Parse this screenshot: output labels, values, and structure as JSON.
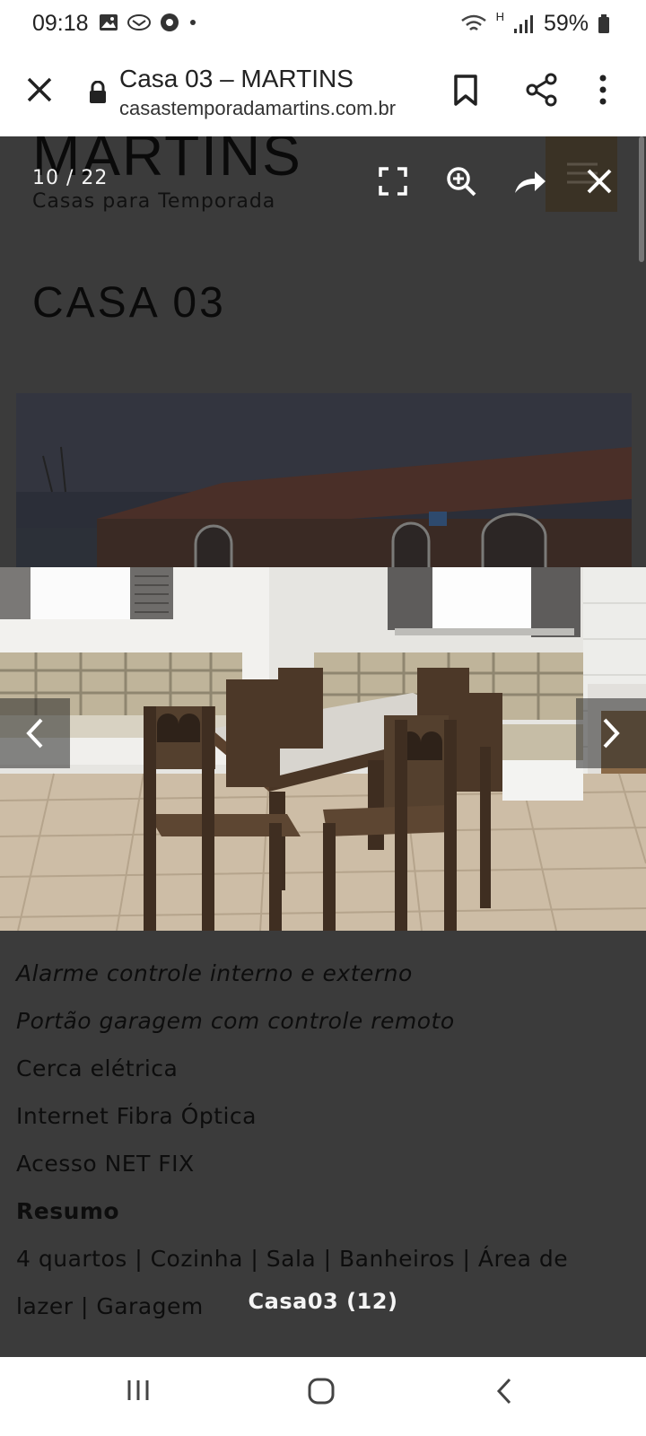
{
  "status_bar": {
    "time": "09:18",
    "network": "H",
    "battery": "59%",
    "icons": [
      "gallery-icon",
      "email-icon",
      "chrome-icon",
      "dot-icon",
      "wifi-icon",
      "signal-icon",
      "battery-icon"
    ]
  },
  "browser": {
    "page_title": "Casa 03 – MARTINS",
    "url": "casastemporadamartins.com.br"
  },
  "site": {
    "brand": "MARTINS",
    "tagline": "Casas para Temporada",
    "heading": "CASA 03"
  },
  "lightbox": {
    "counter": "10 / 22",
    "caption": "Casa03 (12)"
  },
  "features": [
    {
      "text": "Alarme controle interno e externo",
      "style": "italic"
    },
    {
      "text": "Portão garagem com controle remoto",
      "style": "italic"
    },
    {
      "text": "Cerca elétrica",
      "style": "normal"
    },
    {
      "text": "Internet Fibra Óptica",
      "style": "normal"
    },
    {
      "text": "Acesso NET FIX",
      "style": "normal"
    },
    {
      "text": "Resumo",
      "style": "bold"
    },
    {
      "text": "4 quartos | Cozinha | Sala | Banheiros | Área de",
      "style": "normal"
    },
    {
      "text": "lazer | Garagem",
      "style": "normal"
    }
  ],
  "colors": {
    "overlay_bg": "#3b3b3b",
    "wall": "#e9e9e6",
    "wood": "#4a3626",
    "tile": "#c9b79e"
  }
}
